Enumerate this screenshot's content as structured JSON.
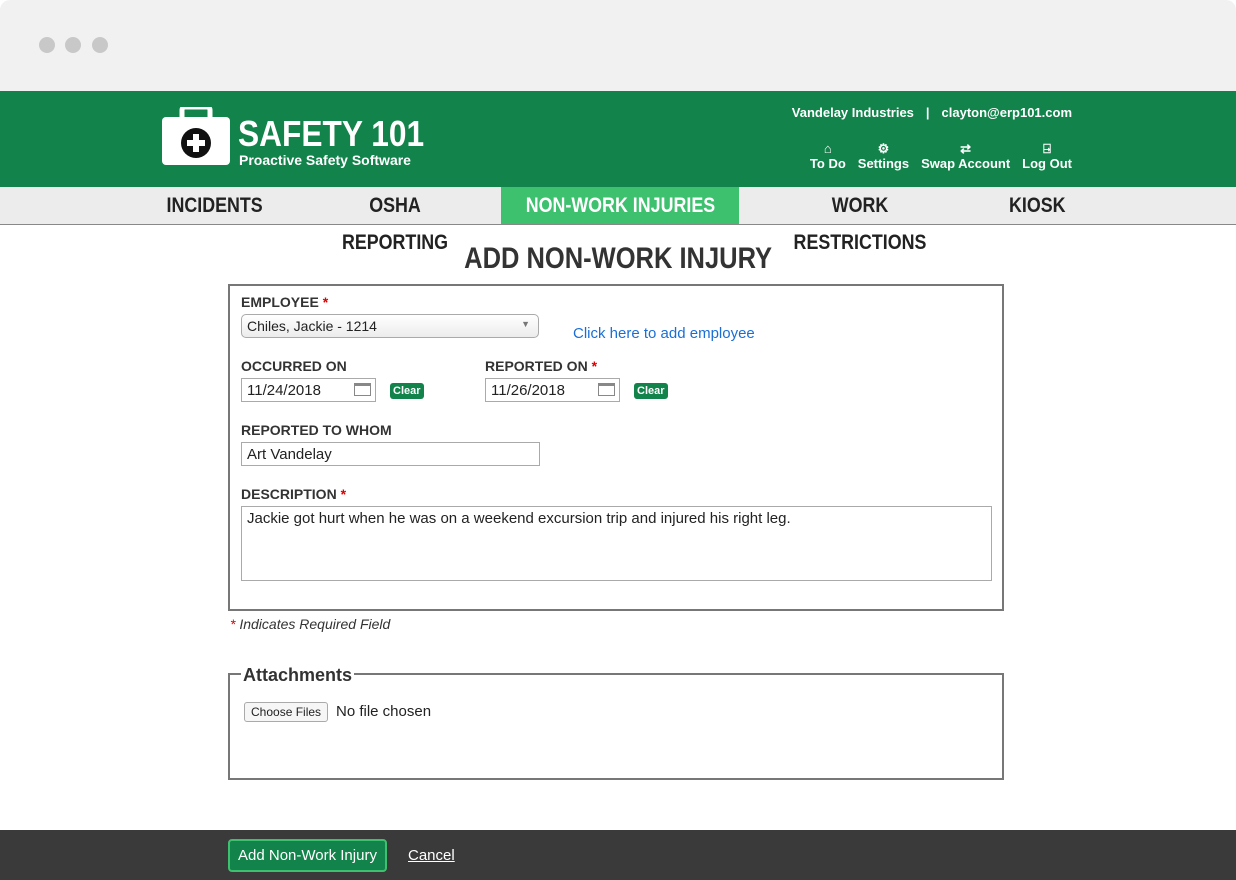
{
  "header": {
    "brand": "SAFETY 101",
    "tagline": "Proactive Safety Software",
    "company": "Vandelay Industries",
    "email": "clayton@erp101.com",
    "links": [
      {
        "label": "To Do",
        "icon": "home-icon"
      },
      {
        "label": "Settings",
        "icon": "gear-icon"
      },
      {
        "label": "Swap Account",
        "icon": "swap-icon"
      },
      {
        "label": "Log Out",
        "icon": "logout-icon"
      }
    ]
  },
  "nav": {
    "tabs": [
      "INCIDENTS",
      "OSHA REPORTING",
      "NON-WORK INJURIES",
      "WORK RESTRICTIONS",
      "KIOSK"
    ],
    "active": "NON-WORK INJURIES"
  },
  "page_title": "ADD NON-WORK INJURY",
  "form": {
    "employee_label": "EMPLOYEE",
    "employee_value": "Chiles, Jackie - 1214",
    "add_employee_link": "Click here to add employee",
    "occurred_label": "OCCURRED ON",
    "occurred_value": "11/24/2018",
    "reported_label": "REPORTED ON",
    "reported_value": "11/26/2018",
    "clear_label": "Clear",
    "whom_label": "REPORTED TO WHOM",
    "whom_value": "Art Vandelay",
    "description_label": "DESCRIPTION",
    "description_value": "Jackie got hurt when he was on a weekend excursion trip and injured his right leg.",
    "required_mark": "*",
    "required_note": "Indicates Required Field"
  },
  "attachments": {
    "title": "Attachments",
    "choose_label": "Choose Files",
    "status": "No file chosen"
  },
  "footer": {
    "submit": "Add Non-Work Injury",
    "cancel": "Cancel"
  },
  "colors": {
    "brand": "#12834a",
    "active_tab": "#3ec16f"
  }
}
